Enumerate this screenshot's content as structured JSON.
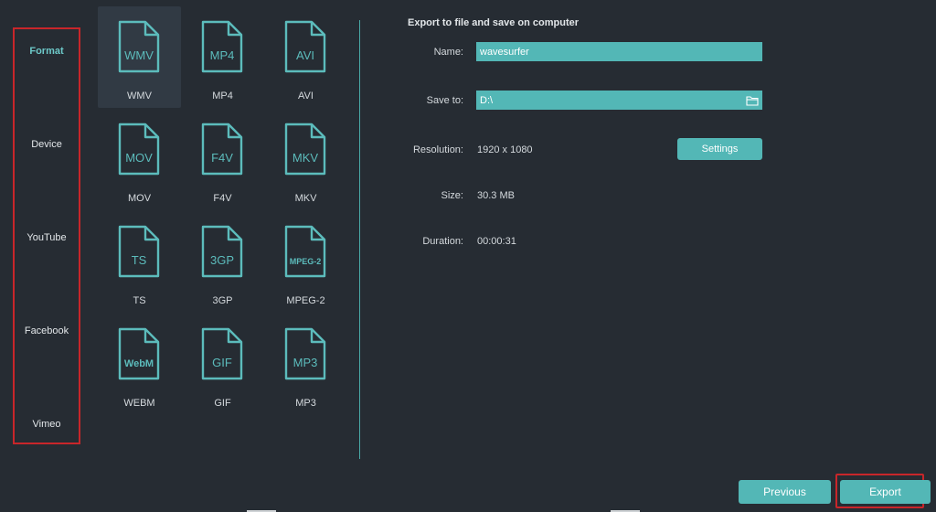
{
  "nav": {
    "items": [
      {
        "label": "Format",
        "active": true
      },
      {
        "label": "Device",
        "active": false
      },
      {
        "label": "YouTube",
        "active": false
      },
      {
        "label": "Facebook",
        "active": false
      },
      {
        "label": "Vimeo",
        "active": false
      }
    ]
  },
  "formats": [
    {
      "icon_text": "WMV",
      "label": "WMV",
      "selected": true
    },
    {
      "icon_text": "MP4",
      "label": "MP4"
    },
    {
      "icon_text": "AVI",
      "label": "AVI"
    },
    {
      "icon_text": "MOV",
      "label": "MOV"
    },
    {
      "icon_text": "F4V",
      "label": "F4V"
    },
    {
      "icon_text": "MKV",
      "label": "MKV"
    },
    {
      "icon_text": "TS",
      "label": "TS"
    },
    {
      "icon_text": "3GP",
      "label": "3GP"
    },
    {
      "icon_text": "MPEG-2",
      "label": "MPEG-2"
    },
    {
      "icon_text": "WebM",
      "label": "WEBM"
    },
    {
      "icon_text": "GIF",
      "label": "GIF"
    },
    {
      "icon_text": "MP3",
      "label": "MP3"
    }
  ],
  "panel": {
    "title": "Export to file and save on computer",
    "name_label": "Name:",
    "name_value": "wavesurfer",
    "save_to_label": "Save to:",
    "save_to_value": "D:\\",
    "resolution_label": "Resolution:",
    "resolution_value": "1920 x 1080",
    "settings_label": "Settings",
    "size_label": "Size:",
    "size_value": "30.3 MB",
    "duration_label": "Duration:",
    "duration_value": "00:00:31"
  },
  "footer": {
    "previous_label": "Previous",
    "export_label": "Export"
  },
  "colors": {
    "background": "#262c33",
    "accent": "#53b7b6",
    "icon_stroke": "#5cbcbc",
    "highlight": "#c8262a"
  }
}
